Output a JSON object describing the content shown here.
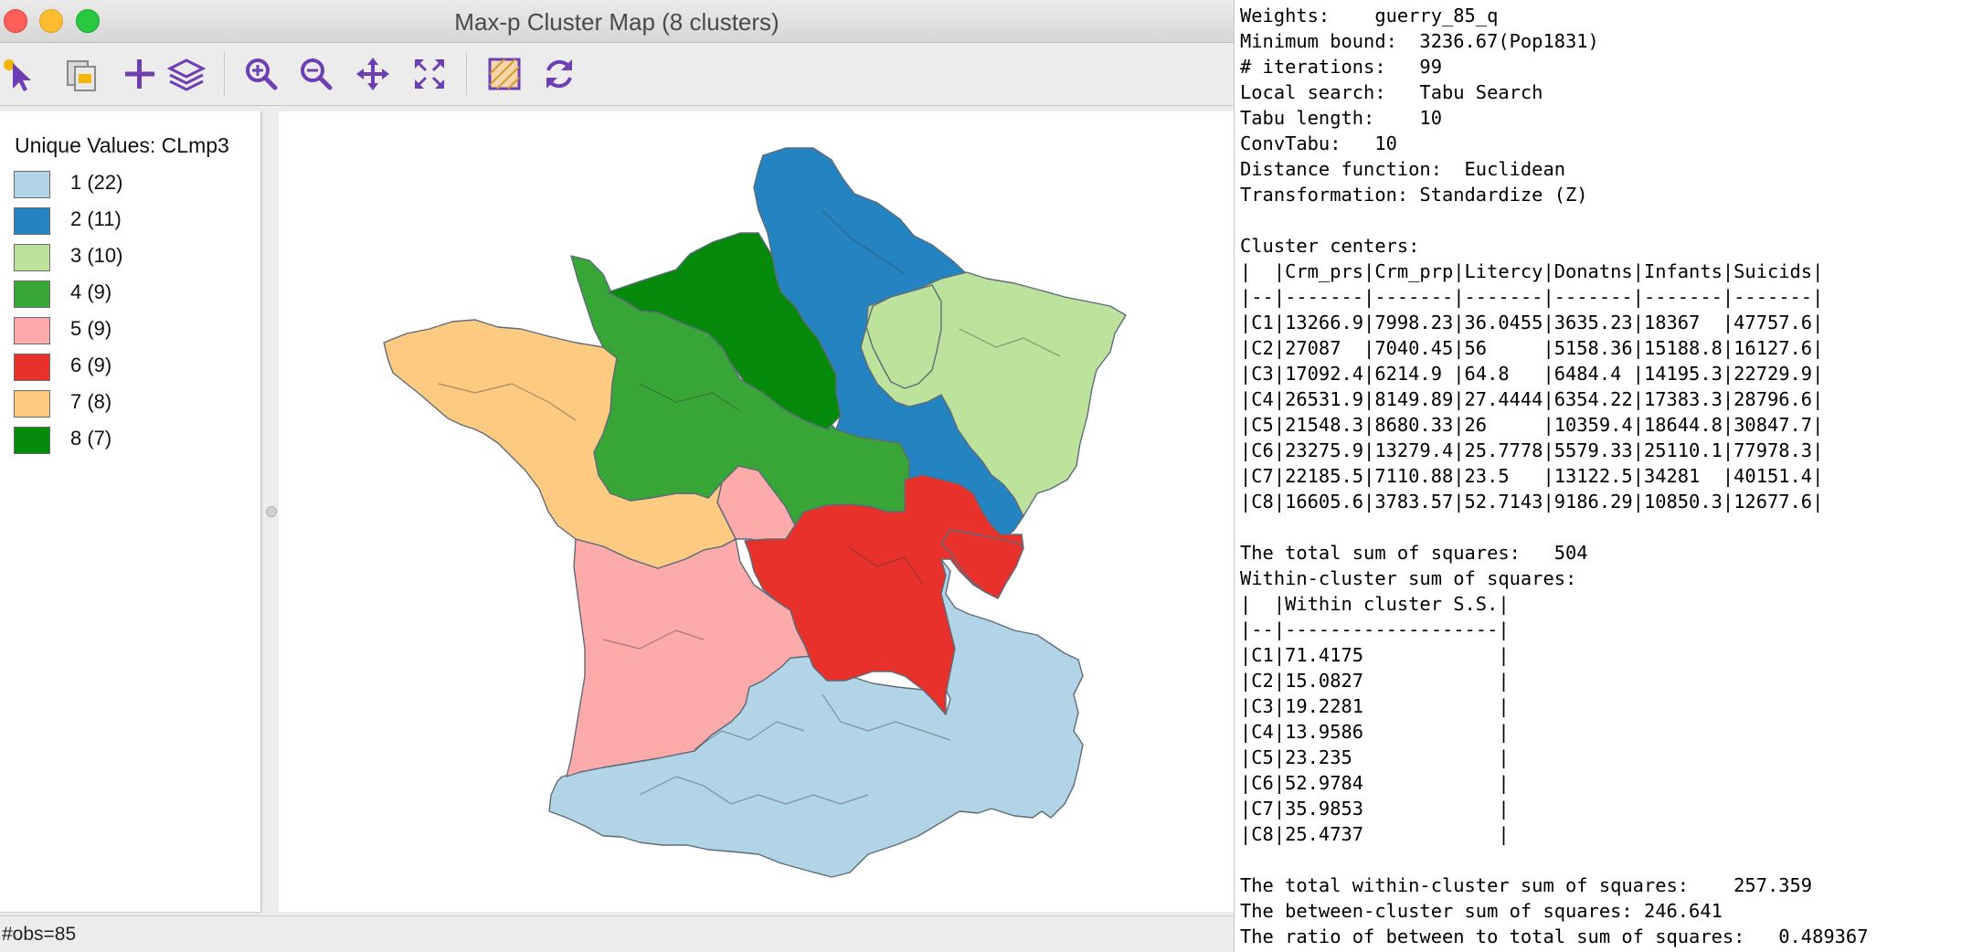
{
  "window": {
    "title": "Max-p Cluster Map (8 clusters)"
  },
  "toolbar": {
    "buttons": [
      {
        "name": "select-tool-icon"
      },
      {
        "name": "copy-image-icon"
      },
      {
        "name": "add-icon"
      },
      {
        "name": "layers-icon"
      },
      {
        "name": "zoom-in-icon"
      },
      {
        "name": "zoom-out-icon"
      },
      {
        "name": "pan-icon"
      },
      {
        "name": "fit-extent-icon"
      },
      {
        "name": "selection-options-icon"
      },
      {
        "name": "refresh-icon"
      }
    ]
  },
  "legend": {
    "title": "Unique Values: CLmp3",
    "items": [
      {
        "label": "1 (22)",
        "color": "#b2d4e7"
      },
      {
        "label": "2 (11)",
        "color": "#2484c2"
      },
      {
        "label": "3 (10)",
        "color": "#bde29b"
      },
      {
        "label": "4 (9)",
        "color": "#37a637"
      },
      {
        "label": "5 (9)",
        "color": "#fcaaaa"
      },
      {
        "label": "6 (9)",
        "color": "#e8312b"
      },
      {
        "label": "7 (8)",
        "color": "#fdca82"
      },
      {
        "label": "8 (7)",
        "color": "#058a0b"
      }
    ]
  },
  "status": {
    "text": "#obs=85"
  },
  "report": {
    "lines": [
      "Weights:    guerry_85_q",
      "Minimum bound:  3236.67(Pop1831)",
      "# iterations:   99",
      "Local search:   Tabu Search",
      "Tabu length:    10",
      "ConvTabu:   10",
      "Distance function:  Euclidean",
      "Transformation: Standardize (Z)",
      "",
      "Cluster centers:",
      "|  |Crm_prs|Crm_prp|Litercy|Donatns|Infants|Suicids|",
      "|--|-------|-------|-------|-------|-------|-------|",
      "|C1|13266.9|7998.23|36.0455|3635.23|18367  |47757.6|",
      "|C2|27087  |7040.45|56     |5158.36|15188.8|16127.6|",
      "|C3|17092.4|6214.9 |64.8   |6484.4 |14195.3|22729.9|",
      "|C4|26531.9|8149.89|27.4444|6354.22|17383.3|28796.6|",
      "|C5|21548.3|8680.33|26     |10359.4|18644.8|30847.7|",
      "|C6|23275.9|13279.4|25.7778|5579.33|25110.1|77978.3|",
      "|C7|22185.5|7110.88|23.5   |13122.5|34281  |40151.4|",
      "|C8|16605.6|3783.57|52.7143|9186.29|10850.3|12677.6|",
      "",
      "The total sum of squares:   504",
      "Within-cluster sum of squares:",
      "|  |Within cluster S.S.|",
      "|--|-------------------|",
      "|C1|71.4175            |",
      "|C2|15.0827            |",
      "|C3|19.2281            |",
      "|C4|13.9586            |",
      "|C5|23.235             |",
      "|C6|52.9784            |",
      "|C7|35.9853            |",
      "|C8|25.4737            |",
      "",
      "The total within-cluster sum of squares:    257.359",
      "The between-cluster sum of squares: 246.641",
      "The ratio of between to total sum of squares:   0.489367"
    ]
  }
}
